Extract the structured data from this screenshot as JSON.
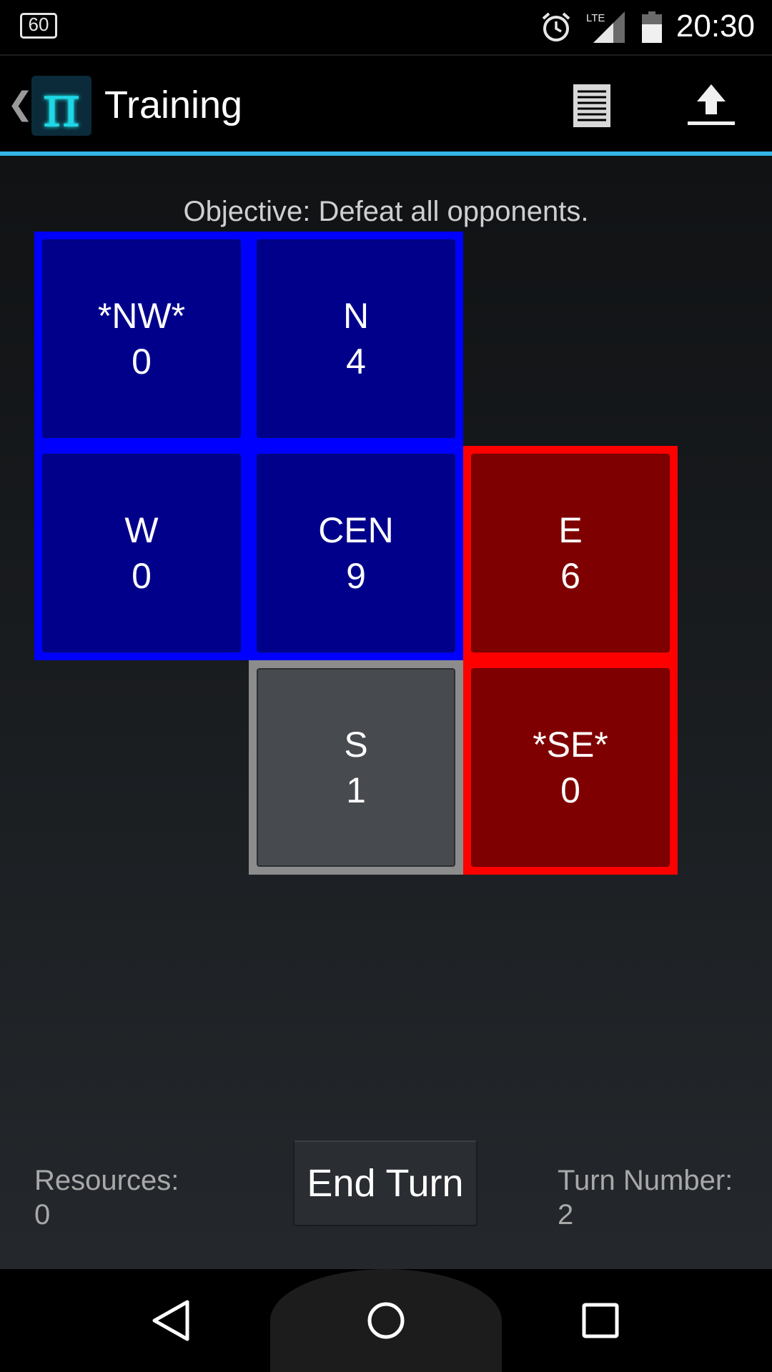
{
  "status_bar": {
    "notification_badge": "60",
    "time": "20:30",
    "network": "LTE",
    "icons": [
      "alarm-icon",
      "signal-icon",
      "battery-icon"
    ]
  },
  "action_bar": {
    "title": "Training",
    "logo_glyph": "π",
    "back_glyph": "❮",
    "actions": [
      "list-icon",
      "upload-icon"
    ]
  },
  "game": {
    "objective": "Objective: Defeat all opponents.",
    "tiles": [
      {
        "id": "nw",
        "name": "*NW*",
        "value": "0",
        "owner": "blue"
      },
      {
        "id": "n",
        "name": "N",
        "value": "4",
        "owner": "blue"
      },
      {
        "id": "w",
        "name": "W",
        "value": "0",
        "owner": "blue"
      },
      {
        "id": "cen",
        "name": "CEN",
        "value": "9",
        "owner": "blue"
      },
      {
        "id": "e",
        "name": "E",
        "value": "6",
        "owner": "red"
      },
      {
        "id": "s",
        "name": "S",
        "value": "1",
        "owner": "neutral"
      },
      {
        "id": "se",
        "name": "*SE*",
        "value": "0",
        "owner": "red"
      }
    ],
    "colors": {
      "blue_team": "#0000ff",
      "red_team": "#ff0000",
      "neutral": "#8c8c8c"
    }
  },
  "footer": {
    "resources_label": "Resources:",
    "resources_value": "0",
    "end_turn_label": "End Turn",
    "turn_label": "Turn Number:",
    "turn_value": "2"
  },
  "nav_bar": {
    "buttons": [
      "back-icon",
      "home-icon",
      "recents-icon"
    ]
  }
}
